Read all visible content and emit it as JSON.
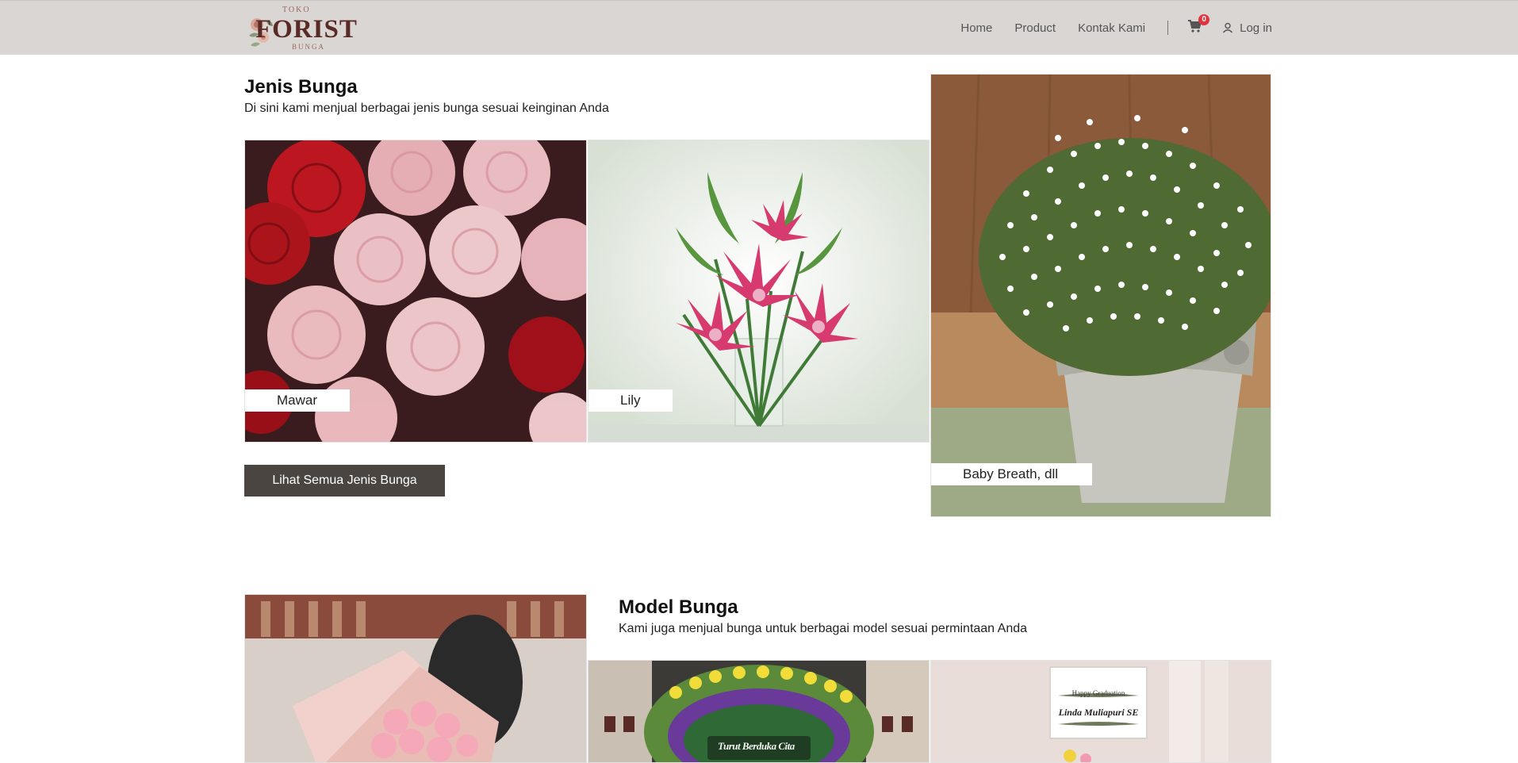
{
  "brand": {
    "top": "TOKO",
    "name": "FORIST",
    "bottom": "BUNGA"
  },
  "nav": {
    "home": "Home",
    "product": "Product",
    "contact": "Kontak Kami",
    "cart_count": "0",
    "login": "Log in"
  },
  "jenis": {
    "title": "Jenis Bunga",
    "subtitle": "Di sini kami menjual berbagai jenis bunga sesuai keinginan Anda",
    "items": [
      {
        "label": "Mawar"
      },
      {
        "label": "Lily"
      },
      {
        "label": "Baby Breath, dll"
      }
    ],
    "button": "Lihat Semua Jenis Bunga"
  },
  "model": {
    "title": "Model Bunga",
    "subtitle": "Kami juga menjual bunga untuk berbagai model sesuai permintaan Anda",
    "board_text": "Turut Berduka Cita",
    "sign_line1": "Happy Graduation",
    "sign_line2": "Linda Muliapuri SE"
  },
  "colors": {
    "navbar": "#d9d6d3",
    "button": "#4a4541",
    "badge": "#e0343f",
    "brand": "#5a2a26"
  }
}
